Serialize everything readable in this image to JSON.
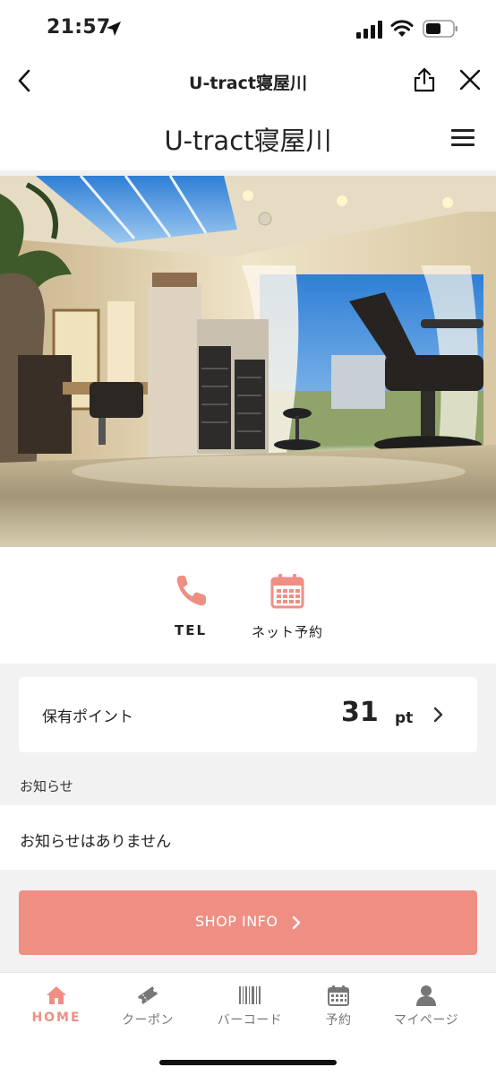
{
  "status_bar": {
    "time": "21:57"
  },
  "browser_nav": {
    "title": "U-tract寝屋川",
    "back_icon": "chevron-left-icon",
    "share_icon": "share-icon",
    "close_icon": "close-icon"
  },
  "site_header": {
    "title": "U-tract寝屋川",
    "menu_icon": "hamburger-menu-icon"
  },
  "hero": {
    "description_icon": "salon-interior-photo"
  },
  "actions": [
    {
      "label": "TEL",
      "icon": "phone-icon"
    },
    {
      "label": "ネット予約",
      "icon": "calendar-icon"
    }
  ],
  "points": {
    "label": "保有ポイント",
    "value": "31",
    "unit": "pt"
  },
  "notice": {
    "heading": "お知らせ",
    "text": "お知らせはありません"
  },
  "shop_info": {
    "label": "SHOP INFO"
  },
  "tabs": [
    {
      "label": "HOME",
      "icon": "home-icon",
      "active": true
    },
    {
      "label": "クーポン",
      "icon": "ticket-icon",
      "active": false
    },
    {
      "label": "バーコード",
      "icon": "barcode-icon",
      "active": false
    },
    {
      "label": "予約",
      "icon": "calendar-icon",
      "active": false
    },
    {
      "label": "マイページ",
      "icon": "person-icon",
      "active": false
    }
  ],
  "colors": {
    "accent": "#ef8f84",
    "background_grey": "#f2f2f2",
    "text": "#222222"
  }
}
